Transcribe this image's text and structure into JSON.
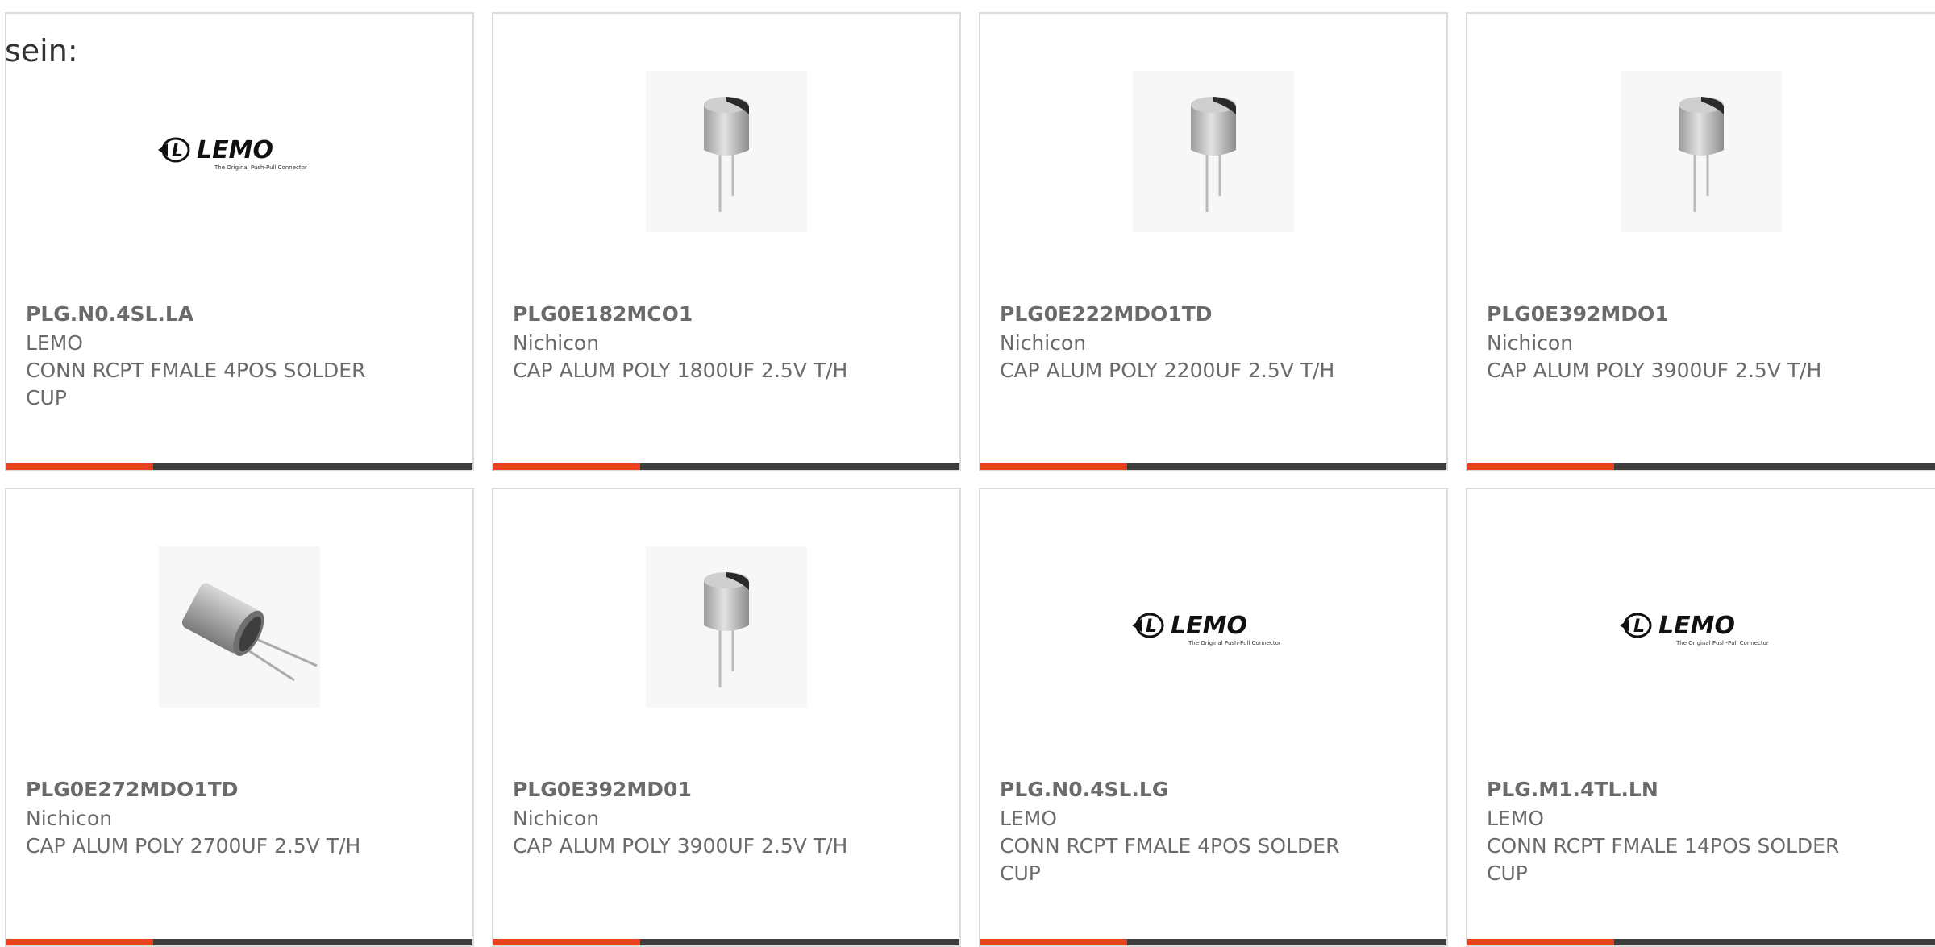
{
  "intro_text": "sein:",
  "colors": {
    "accent": "#e8411b",
    "bar": "#3d3d3d",
    "border": "#dcdcdc",
    "text": "#6a6a6a"
  },
  "products": [
    {
      "part_number": "PLG.N0.4SL.LA",
      "manufacturer": "LEMO",
      "description": "CONN RCPT FMALE 4POS SOLDER CUP",
      "image": "lemo-logo",
      "logo_text": "LEMO",
      "logo_tagline": "The Original Push-Pull Connector"
    },
    {
      "part_number": "PLG0E182MCO1",
      "manufacturer": "Nichicon",
      "description": "CAP ALUM POLY 1800UF 2.5V T/H",
      "image": "capacitor-vertical"
    },
    {
      "part_number": "PLG0E222MDO1TD",
      "manufacturer": "Nichicon",
      "description": "CAP ALUM POLY 2200UF 2.5V T/H",
      "image": "capacitor-vertical"
    },
    {
      "part_number": "PLG0E392MDO1",
      "manufacturer": "Nichicon",
      "description": "CAP ALUM POLY 3900UF 2.5V T/H",
      "image": "capacitor-vertical"
    },
    {
      "part_number": "PLG0E272MDO1TD",
      "manufacturer": "Nichicon",
      "description": "CAP ALUM POLY 2700UF 2.5V T/H",
      "image": "capacitor-tilted"
    },
    {
      "part_number": "PLG0E392MD01",
      "manufacturer": "Nichicon",
      "description": "CAP ALUM POLY 3900UF 2.5V T/H",
      "image": "capacitor-vertical"
    },
    {
      "part_number": "PLG.N0.4SL.LG",
      "manufacturer": "LEMO",
      "description": "CONN RCPT FMALE 4POS SOLDER CUP",
      "image": "lemo-logo",
      "logo_text": "LEMO",
      "logo_tagline": "The Original Push-Pull Connector"
    },
    {
      "part_number": "PLG.M1.4TL.LN",
      "manufacturer": "LEMO",
      "description": "CONN RCPT FMALE 14POS SOLDER CUP",
      "image": "lemo-logo",
      "logo_text": "LEMO",
      "logo_tagline": "The Original Push-Pull Connector"
    }
  ]
}
